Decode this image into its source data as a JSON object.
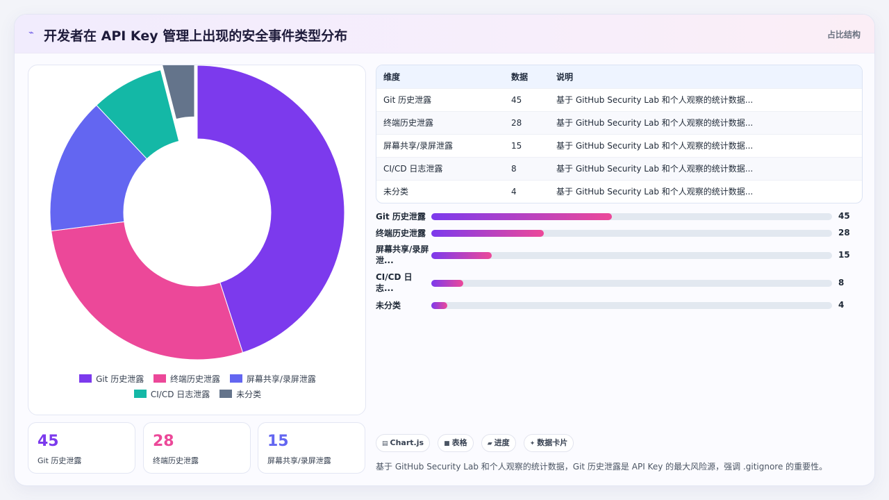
{
  "header": {
    "icon": "sparkline-icon",
    "title": "开发者在 API Key 管理上出现的安全事件类型分布",
    "tag": "占比结构"
  },
  "colors": {
    "git": "#7c3aed",
    "terminal": "#ec4899",
    "screen": "#6366f1",
    "cicd": "#14b8a6",
    "other": "#64748b"
  },
  "chart_data": {
    "type": "pie",
    "donut": true,
    "title": "",
    "categories": [
      "Git 历史泄露",
      "终端历史泄露",
      "屏幕共享/录屏泄露",
      "CI/CD 日志泄露",
      "未分类"
    ],
    "values": [
      45,
      28,
      15,
      8,
      4
    ],
    "colors": [
      "#7c3aed",
      "#ec4899",
      "#6366f1",
      "#14b8a6",
      "#64748b"
    ],
    "exploded_index": 4,
    "legend": "bottom"
  },
  "legend": [
    {
      "label": "Git 历史泄露",
      "color": "#7c3aed"
    },
    {
      "label": "终端历史泄露",
      "color": "#ec4899"
    },
    {
      "label": "屏幕共享/录屏泄露",
      "color": "#6366f1"
    },
    {
      "label": "CI/CD 日志泄露",
      "color": "#14b8a6"
    },
    {
      "label": "未分类",
      "color": "#64748b"
    }
  ],
  "stats": [
    {
      "value": "45",
      "label": "Git 历史泄露",
      "color": "#7c3aed"
    },
    {
      "value": "28",
      "label": "终端历史泄露",
      "color": "#ec4899"
    },
    {
      "value": "15",
      "label": "屏幕共享/录屏泄露",
      "color": "#6366f1"
    }
  ],
  "table": {
    "headers": [
      "维度",
      "数据",
      "说明"
    ],
    "rows": [
      [
        "Git 历史泄露",
        "45",
        "基于 GitHub Security Lab 和个人观察的统计数据..."
      ],
      [
        "终端历史泄露",
        "28",
        "基于 GitHub Security Lab 和个人观察的统计数据..."
      ],
      [
        "屏幕共享/录屏泄露",
        "15",
        "基于 GitHub Security Lab 和个人观察的统计数据..."
      ],
      [
        "CI/CD 日志泄露",
        "8",
        "基于 GitHub Security Lab 和个人观察的统计数据..."
      ],
      [
        "未分类",
        "4",
        "基于 GitHub Security Lab 和个人观察的统计数据..."
      ]
    ]
  },
  "bars": {
    "max": 100,
    "items": [
      {
        "label": "Git 历史泄露",
        "value": 45
      },
      {
        "label": "终端历史泄露",
        "value": 28
      },
      {
        "label": "屏幕共享/录屏泄...",
        "value": 15
      },
      {
        "label": "CI/CD 日志...",
        "value": 8
      },
      {
        "label": "未分类",
        "value": 4
      }
    ]
  },
  "chips": [
    {
      "icon": "chart-icon",
      "glyph": "▤",
      "label": "Chart.js"
    },
    {
      "icon": "table-icon",
      "glyph": "■",
      "label": "表格"
    },
    {
      "icon": "progress-icon",
      "glyph": "▰",
      "label": "进度"
    },
    {
      "icon": "sparkle-icon",
      "glyph": "✦",
      "label": "数据卡片"
    }
  ],
  "note": "基于 GitHub Security Lab 和个人观察的统计数据，Git 历史泄露是 API Key 的最大风险源，强调 .gitignore 的重要性。"
}
